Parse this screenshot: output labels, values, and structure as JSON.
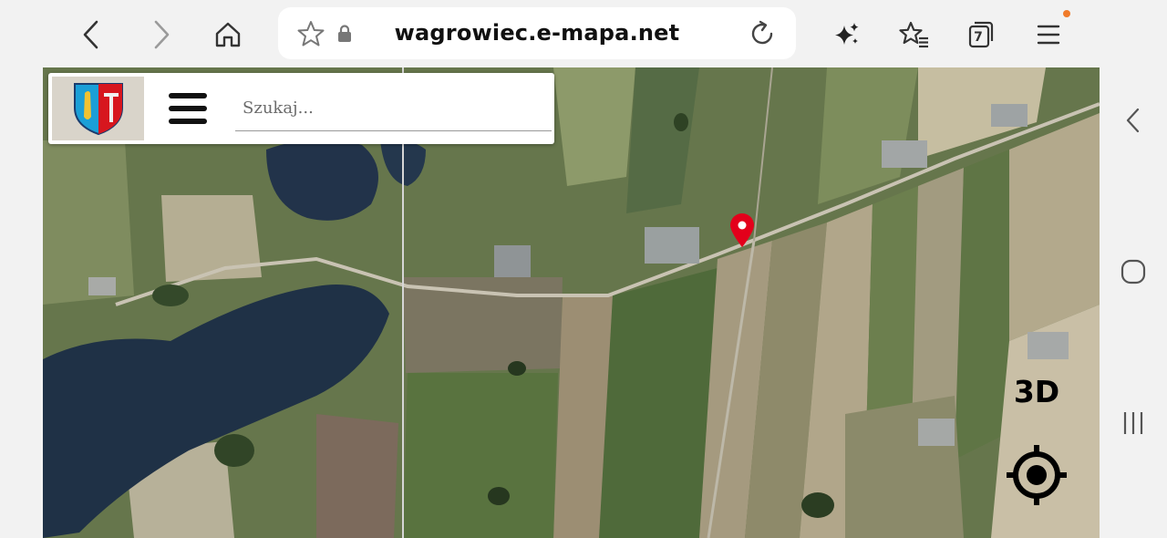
{
  "browser": {
    "url": "wagrowiec.e-mapa.net",
    "tab_count": "7",
    "icons": [
      "back-arrow-icon",
      "forward-arrow-icon",
      "home-icon",
      "bookmark-star-icon",
      "lock-icon",
      "reload-icon",
      "sparkle-icon",
      "bookmarks-list-icon",
      "tabs-icon",
      "menu-icon"
    ]
  },
  "map_app": {
    "search_placeholder": "Szukaj...",
    "btn_3d_label": "3D",
    "marker_color": "#e3001b"
  },
  "system_nav": {
    "icons": [
      "back-chevron-icon",
      "home-circle-icon",
      "recents-icon"
    ]
  }
}
